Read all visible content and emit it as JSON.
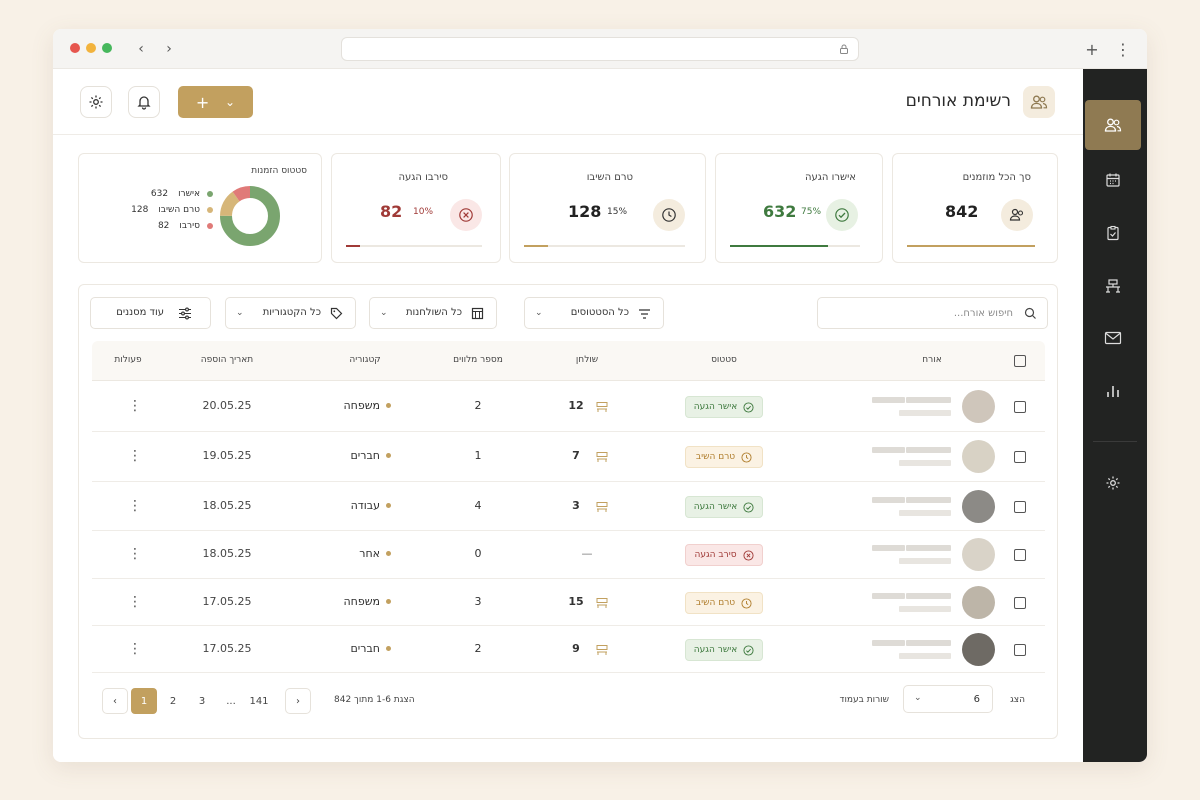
{
  "window": {
    "dots": [
      "#e6564e",
      "#f2b33d",
      "#46b75c"
    ]
  },
  "header": {
    "title": "רשימת אורחים",
    "add_label": "+",
    "add_chevron": "⌄"
  },
  "stats": {
    "total": {
      "label": "סך הכל מוזמנים",
      "value": "842",
      "progress": 1.0
    },
    "confirmed": {
      "label": "אישרו הגעה",
      "value": "632",
      "pct": "75%",
      "progress": 0.75
    },
    "pending": {
      "label": "טרם השיבו",
      "value": "128",
      "pct": "15%",
      "progress": 0.15
    },
    "declined": {
      "label": "סירבו הגעה",
      "value": "82",
      "pct": "10%",
      "progress": 0.1
    },
    "donut": {
      "title": "סטטוס הזמנות",
      "legend": [
        {
          "label": "אישרו",
          "value": "632",
          "color": "#7aa56f"
        },
        {
          "label": "טרם השיבו",
          "value": "128",
          "color": "#d6b679"
        },
        {
          "label": "סירבו",
          "value": "82",
          "color": "#e07a78"
        }
      ],
      "segments": [
        0.75,
        0.15,
        0.1
      ]
    }
  },
  "filters": {
    "search_placeholder": "חיפוש אורח...",
    "status": "כל הסטטוסים",
    "tables": "כל השולחנות",
    "categories": "כל הקטגוריות",
    "more": "עוד מסננים"
  },
  "columns": {
    "guest": "אורח",
    "status": "סטטוס",
    "table": "שולחן",
    "companions": "מספר מלווים",
    "category": "קטגוריה",
    "added": "תאריך הוספה",
    "actions": "פעולות"
  },
  "rows": [
    {
      "status": "אישר הגעה",
      "kind": "ok",
      "table": "12",
      "companions": "2",
      "category": "משפחה",
      "date": "20.05.25",
      "avatar": "#cfc6bb"
    },
    {
      "status": "טרם השיב",
      "kind": "wait",
      "table": "7",
      "companions": "1",
      "category": "חברים",
      "date": "19.05.25",
      "avatar": "#d8d2c5"
    },
    {
      "status": "אישר הגעה",
      "kind": "ok",
      "table": "3",
      "companions": "4",
      "category": "עבודה",
      "date": "18.05.25",
      "avatar": "#8c8a86"
    },
    {
      "status": "סירב הגעה",
      "kind": "no",
      "table": "—",
      "companions": "0",
      "category": "אחר",
      "date": "18.05.25",
      "avatar": "#d9d3c8"
    },
    {
      "status": "טרם השיב",
      "kind": "wait",
      "table": "15",
      "companions": "3",
      "category": "משפחה",
      "date": "17.05.25",
      "avatar": "#bdb5a8"
    },
    {
      "status": "אישר הגעה",
      "kind": "ok",
      "table": "9",
      "companions": "2",
      "category": "חברים",
      "date": "17.05.25",
      "avatar": "#6e6a64"
    }
  ],
  "footer": {
    "show_label": "הצג",
    "rows_per_page": "6",
    "rows_label": "שורות בעמוד",
    "range_text": "הצגת 1-6 מתוך 842",
    "pages": [
      "1",
      "2",
      "3",
      "...",
      "141"
    ],
    "current_page": "1"
  }
}
